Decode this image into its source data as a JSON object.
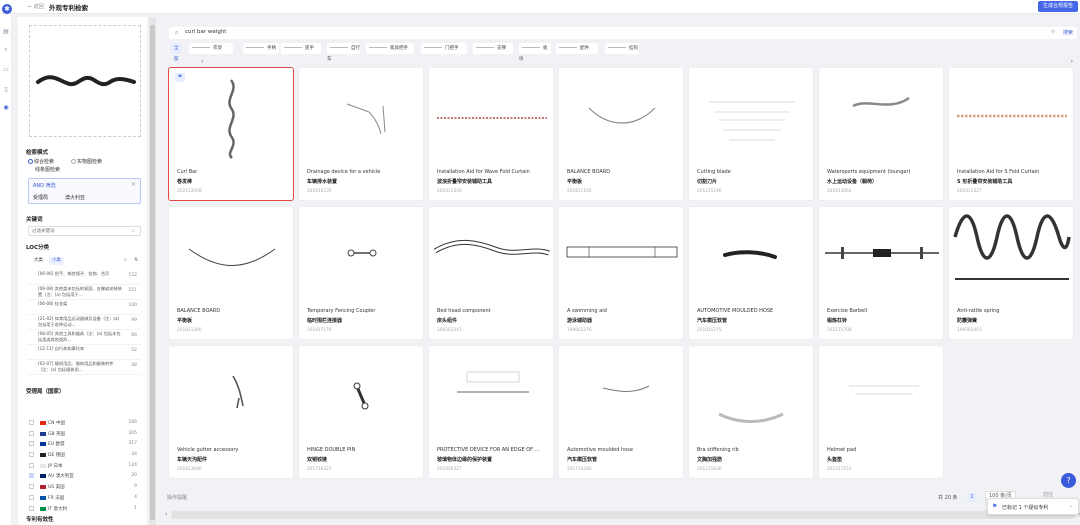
{
  "header": {
    "back_label": "← 返回",
    "title": "外观专利检索",
    "report_button": "生成合规报告"
  },
  "left_panel": {
    "search_mode_title": "检索模式",
    "modes": [
      "综合检索",
      "实物图检索",
      "线条图检索"
    ],
    "and_filter": {
      "title": "AND 筛选",
      "close": "×",
      "conditions": [
        "受理局",
        "澳大利亚"
      ]
    },
    "keyword_title": "关键词",
    "keyword_placeholder": "过滤关键词",
    "loc_title": "LOC分类",
    "loc_tabs": [
      "大类",
      "小类"
    ],
    "loc_items": [
      {
        "text": "[06-06] 把手、梳妆镜子、挂物、合页",
        "count": "152"
      },
      {
        "text": "[08-08] 其他类未包括的紧固、支撑或安装装置（注：(a) 包括用于...",
        "count": "151"
      },
      {
        "text": "[06-08] 挂衣架",
        "count": "100"
      },
      {
        "text": "[21-02] 体育用品运动器械及设备（注：(a) 包括用于各种运动...",
        "count": "99"
      },
      {
        "text": "[08-05] 其他工具和器具（注：(a) 包括未包括类或其他类的...",
        "count": "66"
      },
      {
        "text": "[12-11] 自行车和摩托车",
        "count": "52"
      },
      {
        "text": "[02-07] 缝纫用品、服饰用品和服装附件（注：(a) 包括服装用...",
        "count": "48"
      }
    ],
    "office_title": "受理局（国家）",
    "countries": [
      {
        "code": "CN",
        "name": "中国",
        "count": "186",
        "checked": false,
        "flag": "#de2910"
      },
      {
        "code": "GB",
        "name": "英国",
        "count": "305",
        "checked": false,
        "flag": "#1f3a93"
      },
      {
        "code": "EU",
        "name": "欧盟",
        "count": "317",
        "checked": false,
        "flag": "#003399"
      },
      {
        "code": "DE",
        "name": "德国",
        "count": "34",
        "checked": false,
        "flag": "#222222"
      },
      {
        "code": "JP",
        "name": "日本",
        "count": "124",
        "checked": false,
        "flag": "#e6e6e6"
      },
      {
        "code": "AU",
        "name": "澳大利亚",
        "count": "20",
        "checked": true,
        "flag": "#012169"
      },
      {
        "code": "US",
        "name": "美国",
        "count": "9",
        "checked": false,
        "flag": "#b22234"
      },
      {
        "code": "FR",
        "name": "法国",
        "count": "4",
        "checked": false,
        "flag": "#0055a4"
      },
      {
        "code": "IT",
        "name": "意大利",
        "count": "1",
        "checked": false,
        "flag": "#009246"
      }
    ],
    "validity_title": "专利有效性"
  },
  "search": {
    "query": "curl bar weight",
    "go_label": "搜索"
  },
  "categories": {
    "all_label": "全部",
    "items": [
      "衣架",
      "手柄",
      "扳手",
      "自行车",
      "家具把手",
      "门把手",
      "支撑",
      "板块",
      "配件",
      "挂钩"
    ]
  },
  "results": [
    {
      "en": "Curl Bar",
      "cn": "卷发棒",
      "id": "202113598",
      "selected": true
    },
    {
      "en": "Drainage device for a vehicle",
      "cn": "车辆排水装置",
      "id": "201816235",
      "selected": false
    },
    {
      "en": "Installation Aid for Wave Fold Curtain",
      "cn": "波浪折叠帘安装辅助工具",
      "id": "202411330",
      "selected": false
    },
    {
      "en": "BALANCE BOARD",
      "cn": "平衡板",
      "id": "201811195",
      "selected": false
    },
    {
      "en": "Cutting blade",
      "cn": "切割刀片",
      "id": "201115166",
      "selected": false
    },
    {
      "en": "Watersports equipment (lounger)",
      "cn": "水上运动设备（躺椅）",
      "id": "201913662",
      "selected": false
    },
    {
      "en": "Installation Aid for S Fold Curtain",
      "cn": "S 形折叠帘安装辅助工具",
      "id": "202411327",
      "selected": false
    },
    {
      "en": "BALANCE BOARD",
      "cn": "平衡板",
      "id": "201811200",
      "selected": false
    },
    {
      "en": "Temporary Fencing Coupler",
      "cn": "临时围栏连接器",
      "id": "201817176",
      "selected": false
    },
    {
      "en": "Bed head component",
      "cn": "床头组件",
      "id": "200201343",
      "selected": false
    },
    {
      "en": "A swimming aid",
      "cn": "游泳辅助器",
      "id": "199602276",
      "selected": false
    },
    {
      "en": "AUTOMOTIVE MOULDED HOSE",
      "cn": "汽车模压软管",
      "id": "201815275",
      "selected": false
    },
    {
      "en": "Exercise Barbell",
      "cn": "锻炼杠铃",
      "id": "202115708",
      "selected": false
    },
    {
      "en": "Anti-rattle spring",
      "cn": "防震弹簧",
      "id": "199502403",
      "selected": false
    },
    {
      "en": "Vehicle gutter accessory",
      "cn": "车辆天沟配件",
      "id": "201813690",
      "selected": false
    },
    {
      "en": "HINGE DOUBLE PIN",
      "cn": "双销铰链",
      "id": "201716322",
      "selected": false
    },
    {
      "en": "PROTECTIVE DEVICE FOR AN EDGE OF ...",
      "cn": "玻璃物体边缘的保护装置",
      "id": "201916327",
      "selected": false
    },
    {
      "en": "Automotive moulded hose",
      "cn": "汽车模压软管",
      "id": "201714280",
      "selected": false
    },
    {
      "en": "Bra stiffening rib",
      "cn": "文胸加强筋",
      "id": "201215936",
      "selected": false
    },
    {
      "en": "Helmet pad",
      "cn": "头盔垫",
      "id": "202317251",
      "selected": false
    }
  ],
  "footer": {
    "tip": "操作提醒",
    "total": "共 20 条",
    "page": "1",
    "page_size": "100 条/页",
    "goto": "前往",
    "marked": "已标记 1 个疑似专利"
  },
  "colors": {
    "accent": "#3a5bd9",
    "selected_border": "#e54646"
  }
}
